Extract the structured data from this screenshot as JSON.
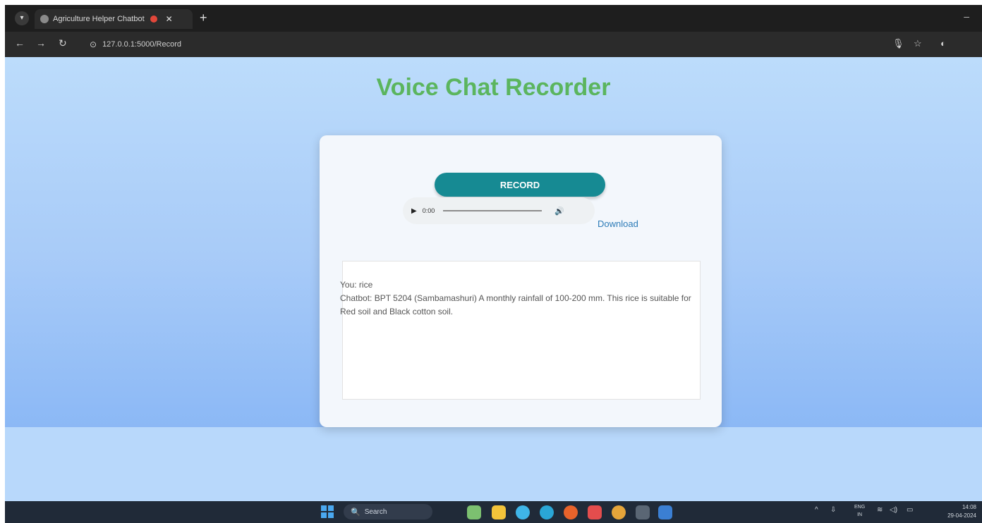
{
  "browser": {
    "tab_title": "Agriculture Helper Chatbot",
    "tab_close": "✕",
    "new_tab": "+",
    "minimize": "–",
    "url": "127.0.0.1:5000/Record"
  },
  "page": {
    "title": "Voice Chat Recorder",
    "record_label": "RECORD",
    "audio_time": "0:00",
    "download_label": "Download",
    "chat": {
      "user_line": "You: rice",
      "bot_line": "Chatbot: BPT 5204 (Sambamashuri) A monthly rainfall of 100-200 mm. This rice is suitable for Red soil and Black cotton soil."
    }
  },
  "taskbar": {
    "search_label": "Search",
    "lang_top": "ENG",
    "lang_bottom": "IN",
    "time": "14:08",
    "date": "29-04-2024"
  },
  "colors": {
    "title_green": "#5bb55e",
    "record_teal": "#168a93",
    "link_blue": "#2c7bb7"
  },
  "icons": [
    "back-arrow-icon",
    "forward-arrow-icon",
    "reload-icon",
    "site-info-icon",
    "mic-icon",
    "star-icon",
    "profile-icon",
    "play-icon",
    "volume-icon",
    "windows-start-icon",
    "search-icon"
  ]
}
